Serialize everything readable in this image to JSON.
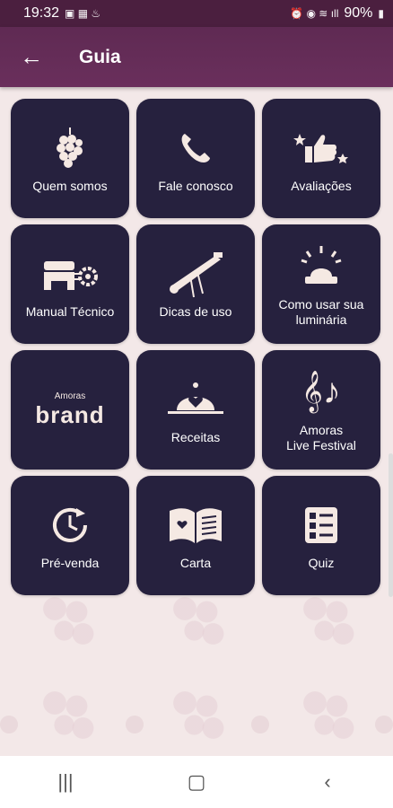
{
  "status": {
    "time": "19:32",
    "battery": "90%"
  },
  "appbar": {
    "title": "Guia"
  },
  "tiles": [
    {
      "label": "Quem somos",
      "icon": "raspberry-icon"
    },
    {
      "label": "Fale conosco",
      "icon": "phone-icon"
    },
    {
      "label": "Avaliações",
      "icon": "thumbs-up-stars-icon"
    },
    {
      "label": "Manual Técnico",
      "icon": "machine-gear-icon"
    },
    {
      "label": "Dicas de uso",
      "icon": "lamp-tool-icon"
    },
    {
      "label": "Como usar sua\nluminária",
      "icon": "luminaire-icon"
    },
    {
      "label": "",
      "icon": "amoras-brand-logo",
      "brand_small": "Amoras",
      "brand_big": "brand"
    },
    {
      "label": "Receitas",
      "icon": "cloche-heart-icon"
    },
    {
      "label": "Amoras\nLive Festival",
      "icon": "music-notes-icon"
    },
    {
      "label": "Pré-venda",
      "icon": "clock-refresh-icon"
    },
    {
      "label": "Carta",
      "icon": "open-book-icon"
    },
    {
      "label": "Quiz",
      "icon": "checklist-icon"
    }
  ],
  "colors": {
    "appbar": "#6a2f5c",
    "tile": "#26213e",
    "background": "#f3e8e8"
  }
}
